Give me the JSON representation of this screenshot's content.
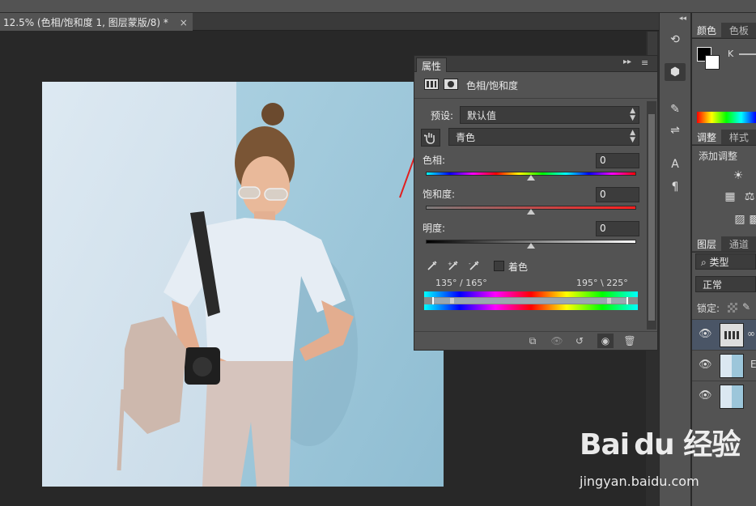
{
  "document": {
    "tab_title": "12.5% (色相/饱和度 1, 图层蒙版/8) *",
    "tab_prefix": "▸",
    "close_glyph": "×"
  },
  "properties": {
    "tab_label": "属性",
    "collapse_glyph": "▸▸",
    "menu_glyph": "≡",
    "adjustment_title": "色相/饱和度",
    "preset_label": "预设:",
    "preset_value": "默认值",
    "channel_value": "青色",
    "hue_label": "色相:",
    "hue_value": "0",
    "saturation_label": "饱和度:",
    "saturation_value": "0",
    "lightness_label": "明度:",
    "lightness_value": "0",
    "colorize_label": "着色",
    "range_left": "135° / 165°",
    "range_right": "195° \\ 225°"
  },
  "right_panels": {
    "color_tab": "颜色",
    "swatches_tab": "色板",
    "k_label": "K",
    "adjust_tab": "调整",
    "styles_tab": "样式",
    "add_adjustment": "添加调整",
    "layers_tab": "图层",
    "channels_tab": "通道",
    "filter_kind": "类型",
    "blend_mode": "正常",
    "lock_label": "锁定:",
    "layer_text_fragment": "E"
  },
  "watermark": {
    "logo": "Bai du 经验",
    "url": "jingyan.baidu.com"
  },
  "colors": {
    "panel_bg": "#535353",
    "panel_dark": "#3c3c3c",
    "canvas_bg": "#282828",
    "arrow_red": "#e02020",
    "selected_layer": "#4a5566"
  }
}
